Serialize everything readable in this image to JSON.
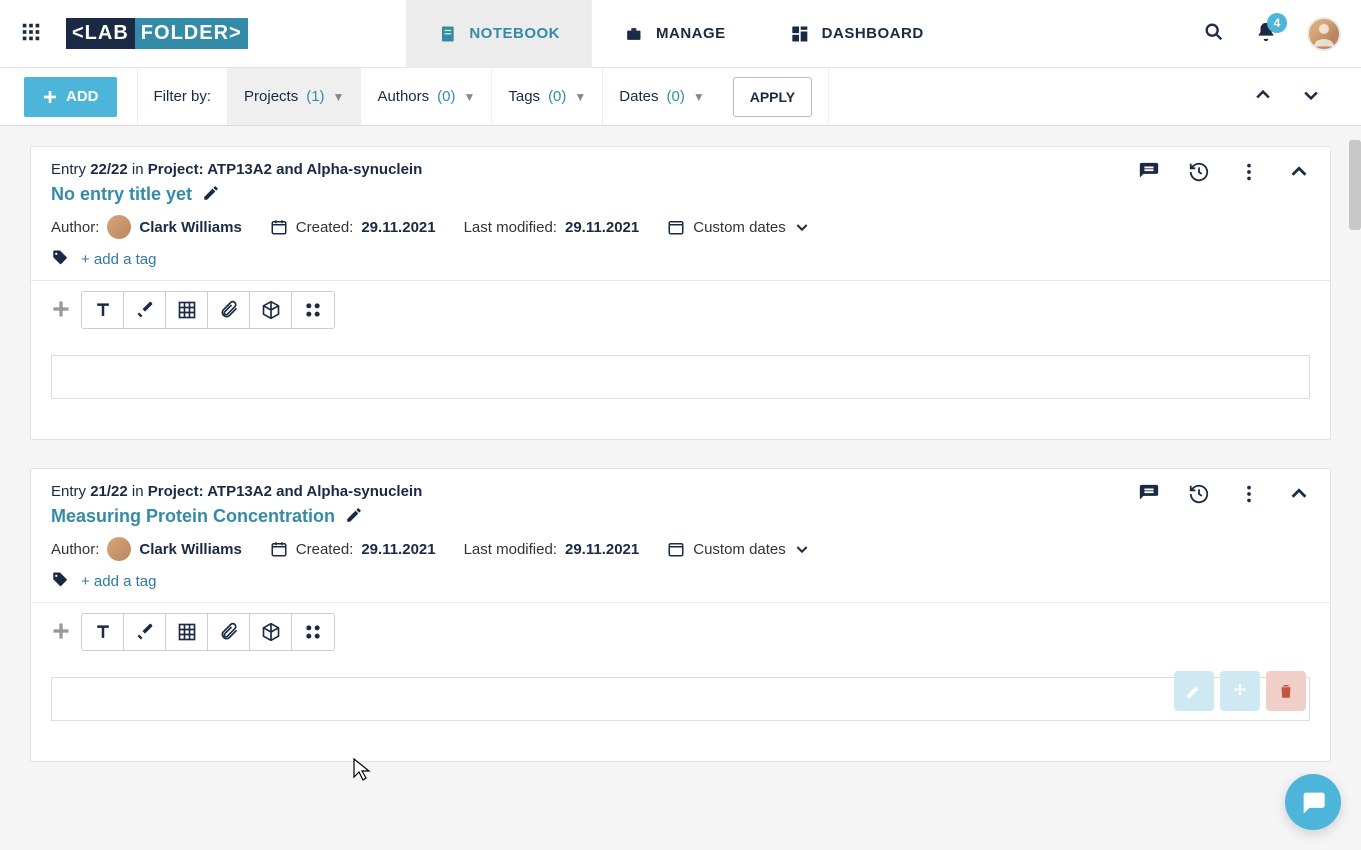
{
  "brand": {
    "left": "<LAB",
    "right": "FOLDER>"
  },
  "main_tabs": {
    "notebook": "NOTEBOOK",
    "manage": "MANAGE",
    "dashboard": "DASHBOARD"
  },
  "notification_count": "4",
  "filters": {
    "add": "ADD",
    "label": "Filter by:",
    "projects_label": "Projects",
    "projects_count": "(1)",
    "authors_label": "Authors",
    "authors_count": "(0)",
    "tags_label": "Tags",
    "tags_count": "(0)",
    "dates_label": "Dates",
    "dates_count": "(0)",
    "apply": "APPLY"
  },
  "entries": [
    {
      "entry_prefix": "Entry ",
      "entry_count": "22/22",
      "in_text": " in ",
      "project_label": "Project: ATP13A2 and Alpha-synuclein",
      "title": "No entry title yet",
      "author_label": "Author:",
      "author_name": "Clark Williams",
      "created_label": "Created: ",
      "created_date": "29.11.2021",
      "modified_label": "Last modified: ",
      "modified_date": "29.11.2021",
      "custom_dates": "Custom dates",
      "add_tag": "+ add a tag"
    },
    {
      "entry_prefix": "Entry ",
      "entry_count": "21/22",
      "in_text": " in ",
      "project_label": "Project: ATP13A2 and Alpha-synuclein",
      "title": "Measuring Protein Concentration",
      "author_label": "Author:",
      "author_name": "Clark Williams",
      "created_label": "Created: ",
      "created_date": "29.11.2021",
      "modified_label": "Last modified: ",
      "modified_date": "29.11.2021",
      "custom_dates": "Custom dates",
      "add_tag": "+ add a tag"
    }
  ]
}
